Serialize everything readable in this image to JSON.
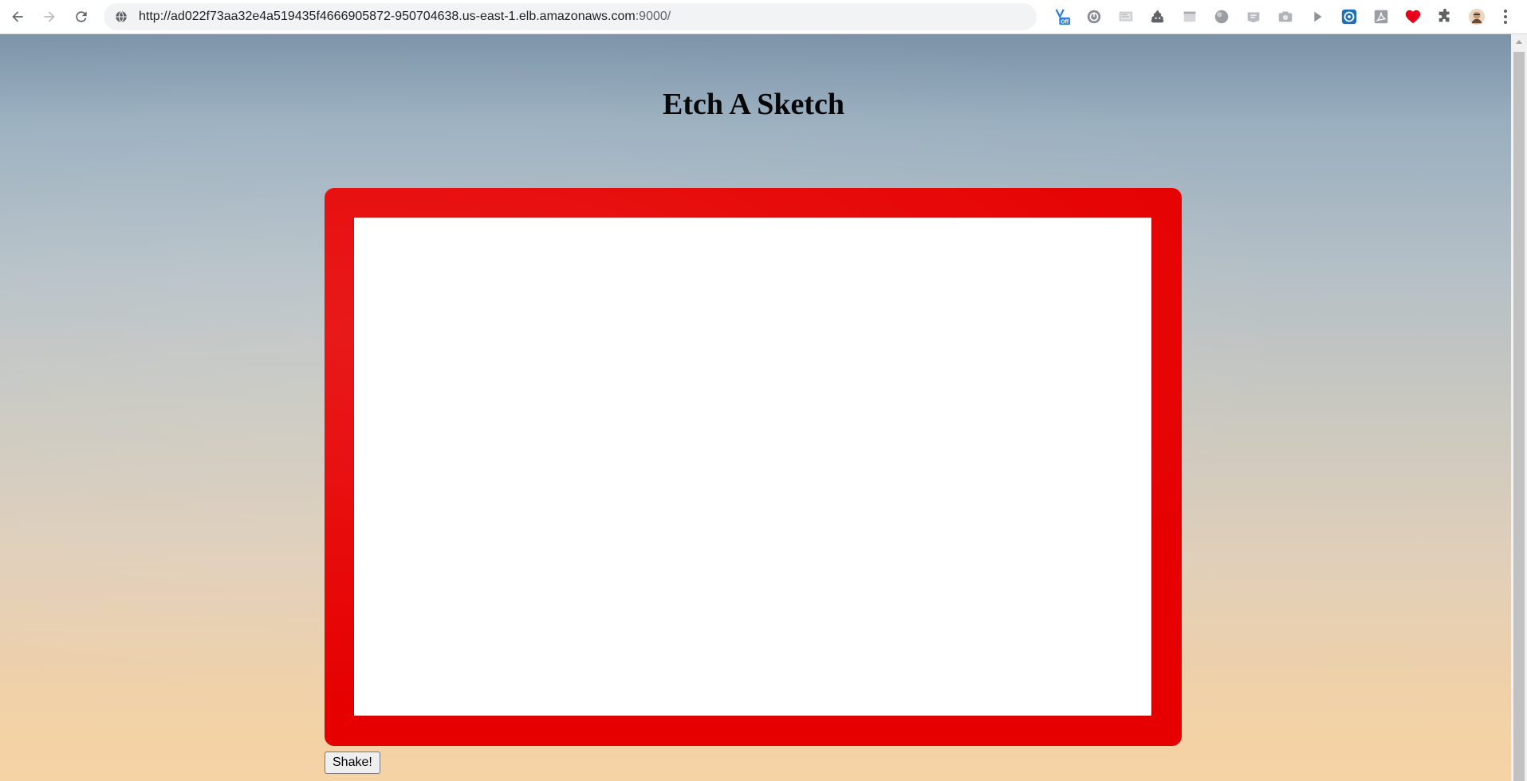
{
  "browser": {
    "url_main": "http://ad022f73aa32e4a519435f4666905872-950704638.us-east-1.elb.amazonaws.com",
    "url_port": ":9000/",
    "extensions": [
      {
        "name": "vimium-off-icon",
        "badge": "Off"
      },
      {
        "name": "power-icon"
      },
      {
        "name": "screen-icon"
      },
      {
        "name": "poop-icon"
      },
      {
        "name": "window-icon"
      },
      {
        "name": "sphere-icon"
      },
      {
        "name": "css-icon"
      },
      {
        "name": "camera-icon"
      },
      {
        "name": "play-icon"
      },
      {
        "name": "target-icon"
      },
      {
        "name": "pdf-icon"
      },
      {
        "name": "heart-icon"
      },
      {
        "name": "puzzle-icon"
      },
      {
        "name": "avatar-icon"
      }
    ]
  },
  "page": {
    "title": "Etch A Sketch",
    "shake_label": "Shake!"
  },
  "colors": {
    "frame": "#e60000",
    "canvas": "#ffffff",
    "accent_heart": "#e8001c",
    "vimium_blue": "#2f7fd8"
  }
}
